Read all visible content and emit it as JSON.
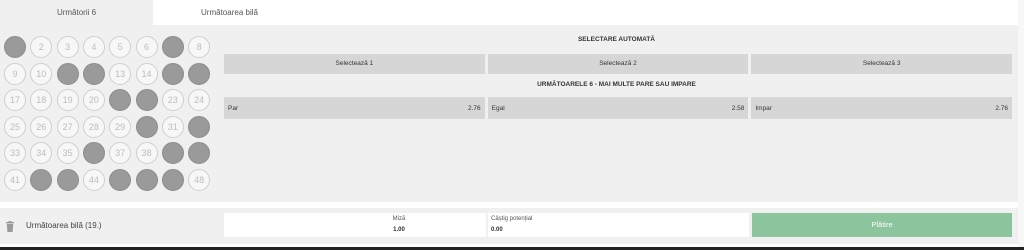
{
  "tabs": [
    {
      "label": "Următorii 6",
      "active": true
    },
    {
      "label": "Următoarea bilă",
      "active": false
    }
  ],
  "balls": [
    {
      "n": "1",
      "drawn": true
    },
    {
      "n": "2",
      "drawn": false
    },
    {
      "n": "3",
      "drawn": false
    },
    {
      "n": "4",
      "drawn": false
    },
    {
      "n": "5",
      "drawn": false
    },
    {
      "n": "6",
      "drawn": false
    },
    {
      "n": "7",
      "drawn": true
    },
    {
      "n": "8",
      "drawn": false
    },
    {
      "n": "9",
      "drawn": false
    },
    {
      "n": "10",
      "drawn": false
    },
    {
      "n": "11",
      "drawn": true
    },
    {
      "n": "12",
      "drawn": true
    },
    {
      "n": "13",
      "drawn": false
    },
    {
      "n": "14",
      "drawn": false
    },
    {
      "n": "15",
      "drawn": true
    },
    {
      "n": "16",
      "drawn": true
    },
    {
      "n": "17",
      "drawn": false
    },
    {
      "n": "18",
      "drawn": false
    },
    {
      "n": "19",
      "drawn": false
    },
    {
      "n": "20",
      "drawn": false
    },
    {
      "n": "21",
      "drawn": true
    },
    {
      "n": "22",
      "drawn": true
    },
    {
      "n": "23",
      "drawn": false
    },
    {
      "n": "24",
      "drawn": false
    },
    {
      "n": "25",
      "drawn": false
    },
    {
      "n": "26",
      "drawn": false
    },
    {
      "n": "27",
      "drawn": false
    },
    {
      "n": "28",
      "drawn": false
    },
    {
      "n": "29",
      "drawn": false
    },
    {
      "n": "30",
      "drawn": true
    },
    {
      "n": "31",
      "drawn": false
    },
    {
      "n": "32",
      "drawn": true
    },
    {
      "n": "33",
      "drawn": false
    },
    {
      "n": "34",
      "drawn": false
    },
    {
      "n": "35",
      "drawn": false
    },
    {
      "n": "36",
      "drawn": true
    },
    {
      "n": "37",
      "drawn": false
    },
    {
      "n": "38",
      "drawn": false
    },
    {
      "n": "39",
      "drawn": true
    },
    {
      "n": "40",
      "drawn": true
    },
    {
      "n": "41",
      "drawn": false
    },
    {
      "n": "42",
      "drawn": true
    },
    {
      "n": "43",
      "drawn": true
    },
    {
      "n": "44",
      "drawn": false
    },
    {
      "n": "45",
      "drawn": true
    },
    {
      "n": "46",
      "drawn": true
    },
    {
      "n": "47",
      "drawn": true
    },
    {
      "n": "48",
      "drawn": false
    }
  ],
  "auto_select": {
    "title": "SELECTARE AUTOMATĂ",
    "buttons": [
      "Selectează 1",
      "Selectează 2",
      "Selectează 3"
    ]
  },
  "market": {
    "title": "URMĂTOARELE 6 - MAI MULTE PARE SAU IMPARE",
    "odds": [
      {
        "label": "Par",
        "value": "2.76"
      },
      {
        "label": "Egal",
        "value": "2.58"
      },
      {
        "label": "Impar",
        "value": "2.76"
      }
    ]
  },
  "bet_slip": {
    "next_label": "Următoarea bilă (19.)",
    "stake_label": "Miză",
    "stake_value": "1.00",
    "win_label": "Câștig potențial",
    "win_value": "0.00",
    "pay_label": "Plătire"
  },
  "colors": {
    "drawn_ball": "#9a9a9a",
    "pay_button": "#8bc49d",
    "panel_bg": "#f0f0f0"
  }
}
